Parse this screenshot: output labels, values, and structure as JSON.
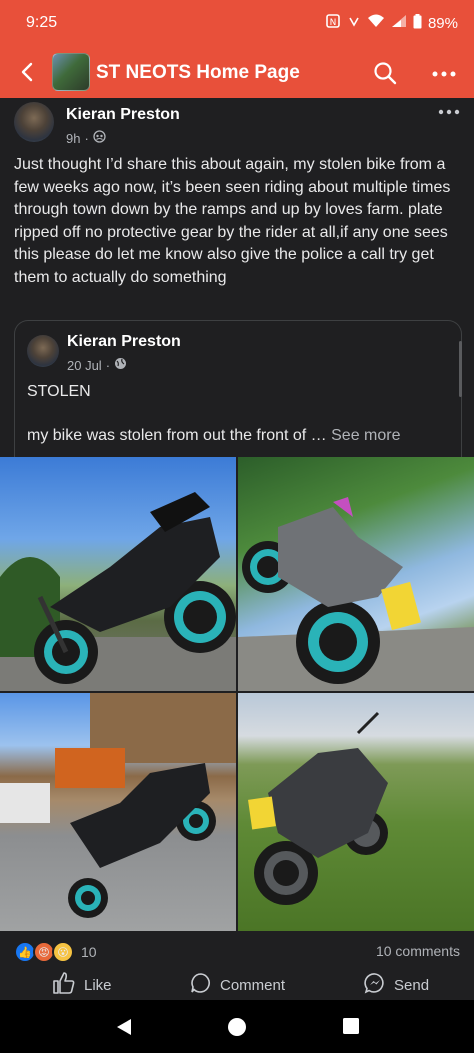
{
  "status_bar": {
    "time": "9:25",
    "battery": "89%",
    "icons": [
      "nfc-icon",
      "vibrate-icon",
      "wifi-icon",
      "signal-icon",
      "battery-icon"
    ]
  },
  "app_bar": {
    "title": "ST NEOTS Home Page",
    "accent": "#e8503a"
  },
  "post": {
    "author": "Kieran Preston",
    "time": "9h",
    "text": "Just thought I’d share this about again, my stolen bike from a few weeks ago now, it’s been seen riding about multiple times through town down by the ramps and up by loves farm. plate ripped off no protective gear by the rider at all,if any one sees this please do let me know also give the police a call try get them to actually do something",
    "shared": {
      "author": "Kieran Preston",
      "date": "20 Jul",
      "headline": "STOLEN",
      "body": "my bike was stolen from out the front of … ",
      "see_more": "See more"
    },
    "reactions_count": "10",
    "comments": "10 comments",
    "actions": {
      "like": "Like",
      "comment": "Comment",
      "send": "Send"
    }
  }
}
